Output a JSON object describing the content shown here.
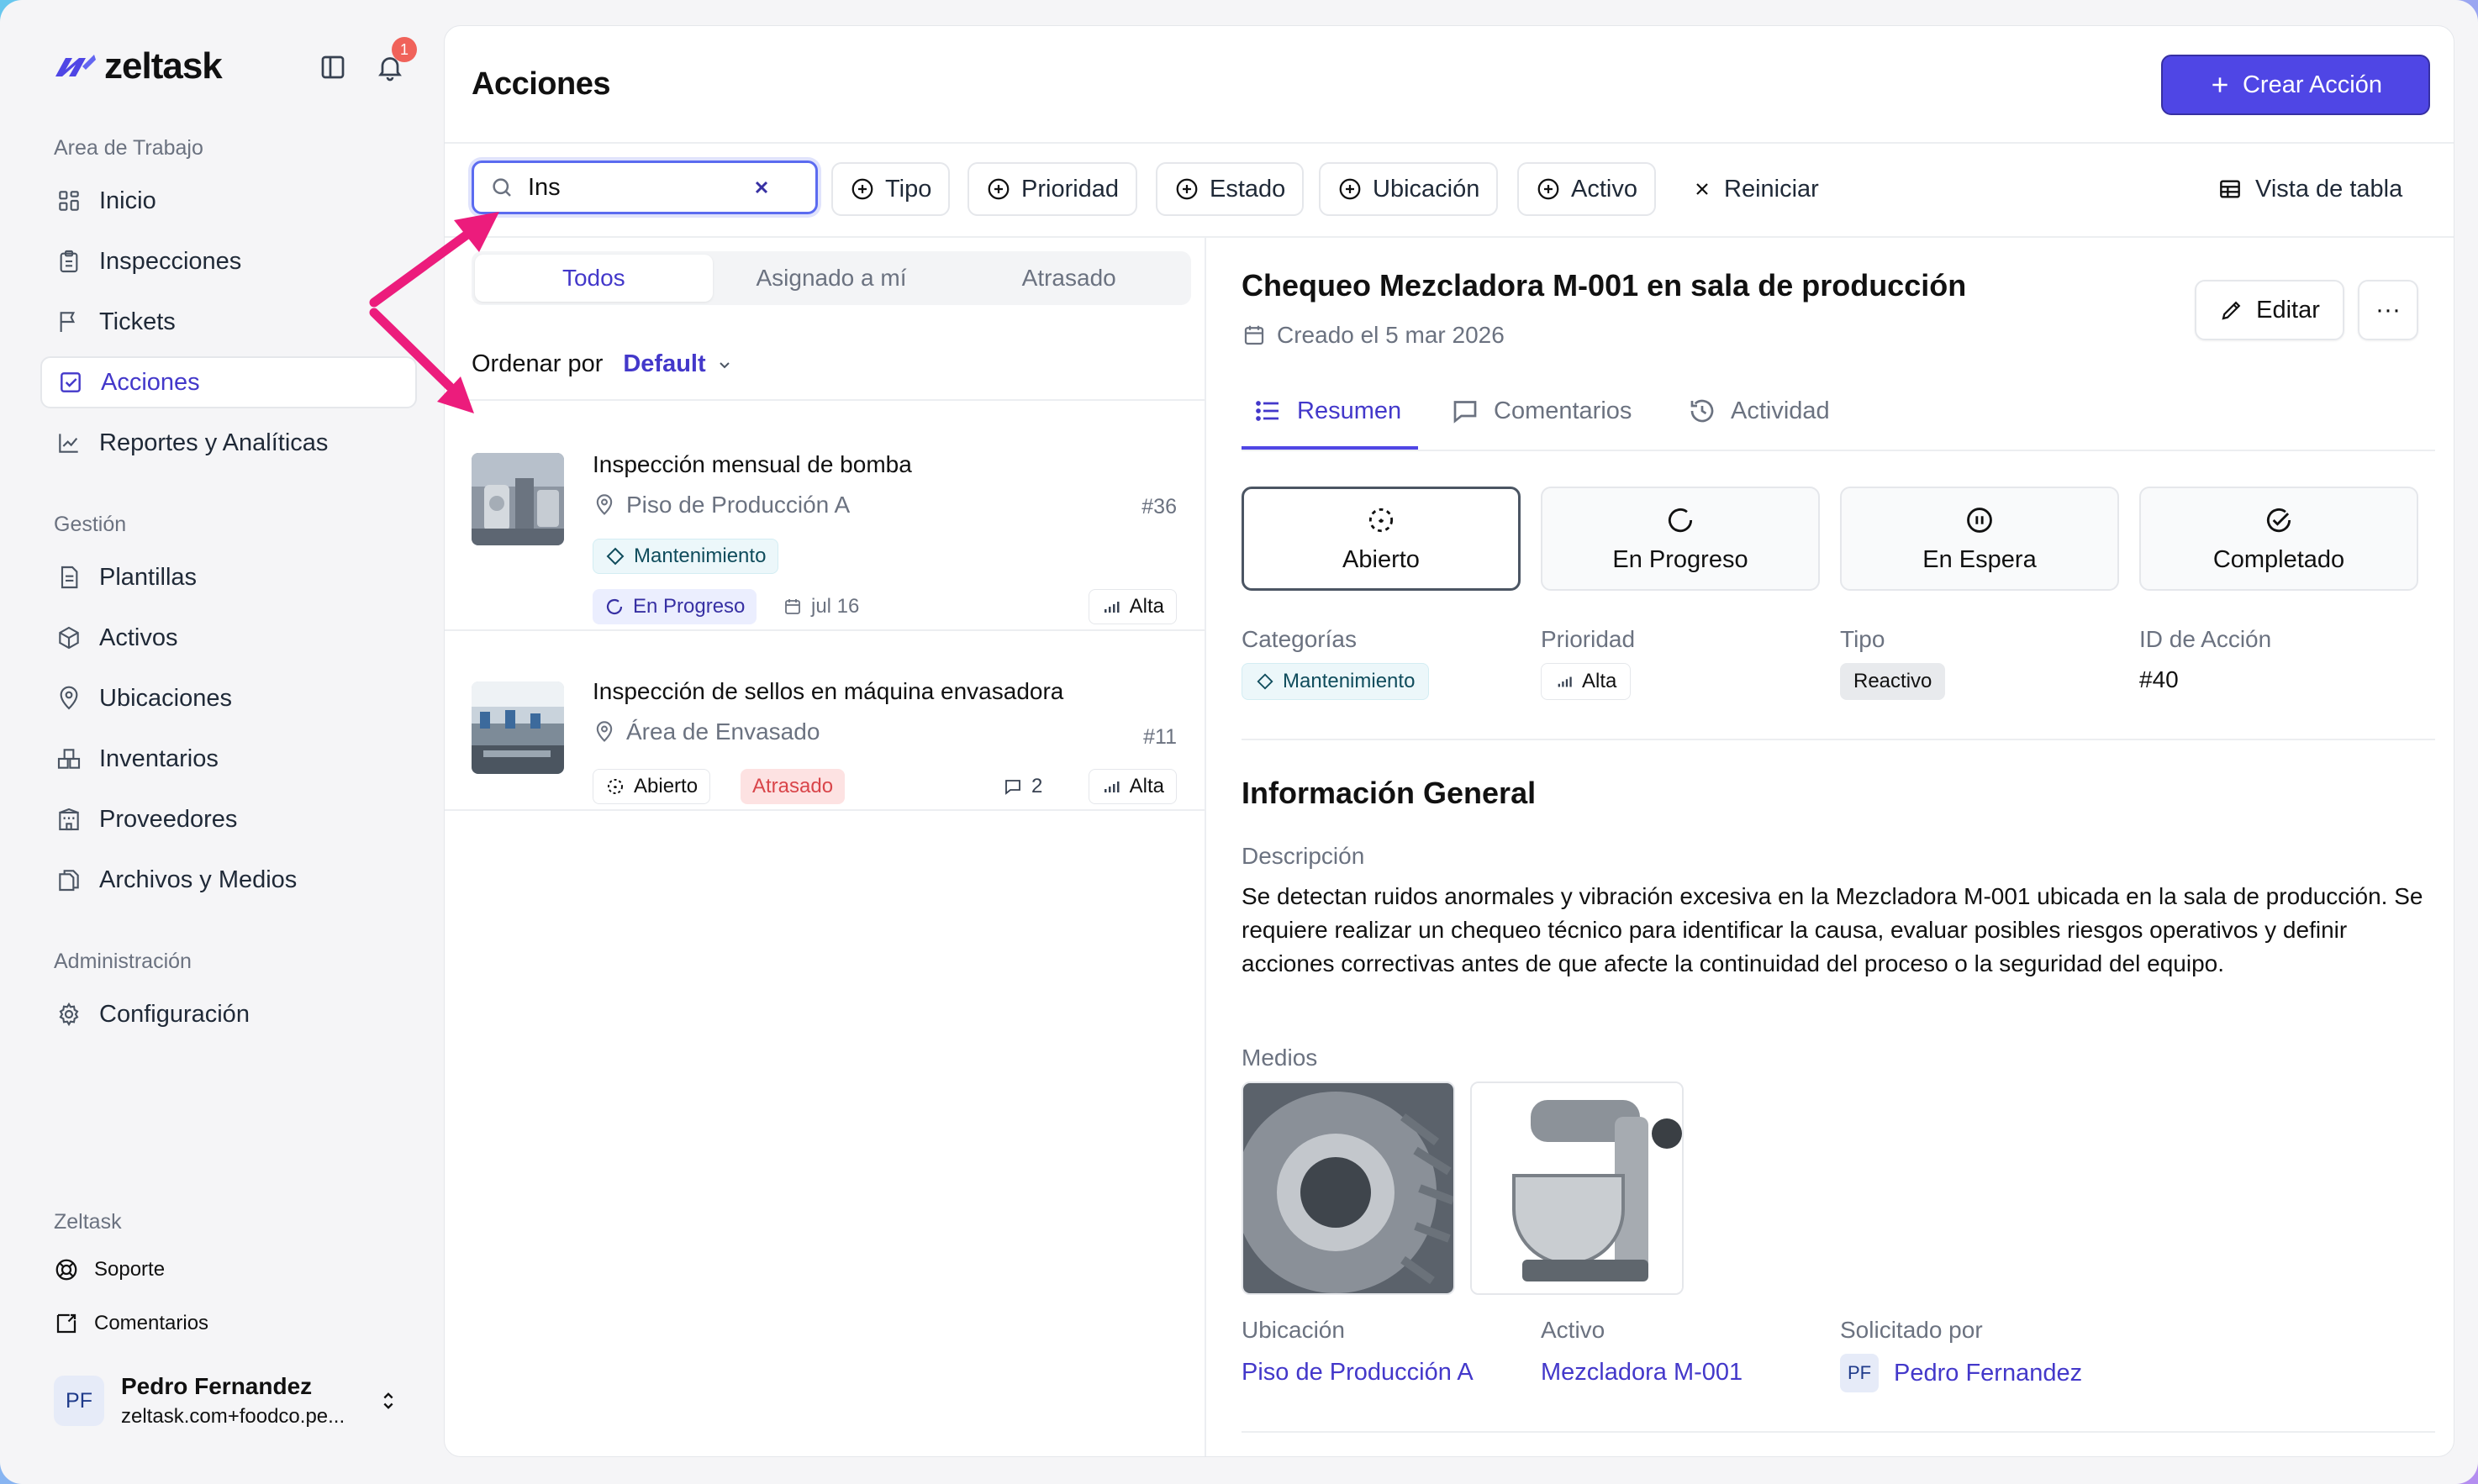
{
  "brand": {
    "name": "zeltask"
  },
  "notifications": {
    "count": "1"
  },
  "sidebar": {
    "workspace_title": "Area de Trabajo",
    "workspace_items": [
      {
        "label": "Inicio",
        "icon": "grid-icon"
      },
      {
        "label": "Inspecciones",
        "icon": "clipboard-icon"
      },
      {
        "label": "Tickets",
        "icon": "flag-icon"
      },
      {
        "label": "Acciones",
        "icon": "checkbox-icon",
        "active": true
      },
      {
        "label": "Reportes y Analíticas",
        "icon": "chart-line-icon"
      }
    ],
    "management_title": "Gestión",
    "management_items": [
      {
        "label": "Plantillas",
        "icon": "document-icon"
      },
      {
        "label": "Activos",
        "icon": "cube-icon"
      },
      {
        "label": "Ubicaciones",
        "icon": "map-pin-icon"
      },
      {
        "label": "Inventarios",
        "icon": "boxes-icon"
      },
      {
        "label": "Proveedores",
        "icon": "building-icon"
      },
      {
        "label": "Archivos y Medios",
        "icon": "files-icon"
      }
    ],
    "admin_title": "Administración",
    "admin_items": [
      {
        "label": "Configuración",
        "icon": "gear-icon"
      }
    ],
    "footer_title": "Zeltask",
    "footer_items": [
      {
        "label": "Soporte",
        "icon": "lifebuoy-icon"
      },
      {
        "label": "Comentarios",
        "icon": "feedback-icon"
      }
    ],
    "user": {
      "initials": "PF",
      "name": "Pedro Fernandez",
      "email": "zeltask.com+foodco.pe..."
    }
  },
  "header": {
    "title": "Acciones",
    "create_label": "Crear Acción"
  },
  "filters": {
    "search_value": "Ins",
    "buttons": [
      "Tipo",
      "Prioridad",
      "Estado",
      "Ubicación",
      "Activo"
    ],
    "reset_label": "Reiniciar",
    "table_view_label": "Vista de tabla"
  },
  "list": {
    "tabs": [
      "Todos",
      "Asignado a mí",
      "Atrasado"
    ],
    "active_tab": "Todos",
    "sort_label": "Ordenar por",
    "sort_value": "Default",
    "items": [
      {
        "title": "Inspección mensual de bomba",
        "location": "Piso de Producción A",
        "number": "#36",
        "category": "Mantenimiento",
        "status": "En Progreso",
        "date": "jul 16",
        "priority": "Alta"
      },
      {
        "title": "Inspección de sellos en máquina envasadora",
        "location": "Área de Envasado",
        "number": "#11",
        "status": "Abierto",
        "overdue": "Atrasado",
        "comments": "2",
        "priority": "Alta"
      }
    ]
  },
  "detail": {
    "title": "Chequeo Mezcladora M-001 en sala de producción",
    "created": "Creado el 5 mar 2026",
    "edit_label": "Editar",
    "more_label": "···",
    "tabs": [
      "Resumen",
      "Comentarios",
      "Actividad"
    ],
    "active_tab": "Resumen",
    "statuses": [
      "Abierto",
      "En Progreso",
      "En Espera",
      "Completado"
    ],
    "active_status": "Abierto",
    "fields": {
      "categories_label": "Categorías",
      "categories_value": "Mantenimiento",
      "priority_label": "Prioridad",
      "priority_value": "Alta",
      "type_label": "Tipo",
      "type_value": "Reactivo",
      "id_label": "ID de Acción",
      "id_value": "#40"
    },
    "general_title": "Información General",
    "description_label": "Descripción",
    "description": "Se detectan ruidos anormales y vibración excesiva en la Mezcladora M-001 ubicada en la sala de producción. Se requiere realizar un chequeo técnico para identificar la causa, evaluar posibles riesgos operativos y definir acciones correctivas antes de que afecte la continuidad del proceso o la seguridad del equipo.",
    "media_label": "Medios",
    "location_label": "Ubicación",
    "location_value": "Piso de Producción A",
    "asset_label": "Activo",
    "asset_value": "Mezcladora M-001",
    "requested_label": "Solicitado por",
    "requested_initials": "PF",
    "requested_value": "Pedro Fernandez"
  },
  "colors": {
    "accent": "#4f46e5",
    "annotation": "#ec1c7c",
    "overdue_bg": "#fde2e2",
    "overdue_text": "#d9454a"
  }
}
